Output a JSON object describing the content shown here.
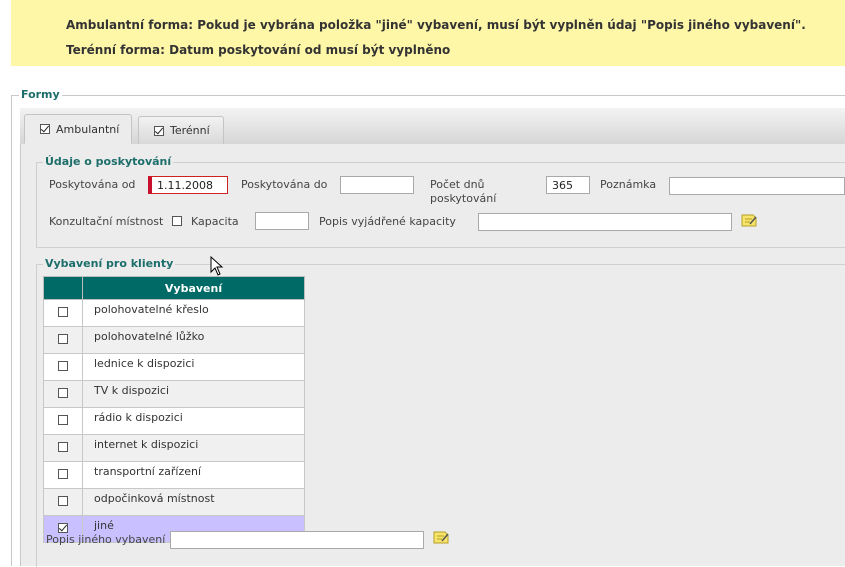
{
  "alert": {
    "line1": "Ambulantní forma: Pokud je vybrána položka \"jiné\" vybavení, musí být vyplněn údaj \"Popis jiného vybavení\".",
    "line2": "Terénní forma: Datum poskytování od musí být vyplněno"
  },
  "forms": {
    "legend": "Formy",
    "tabs": [
      {
        "label": "Ambulantní",
        "checked": true,
        "active": true
      },
      {
        "label": "Terénní",
        "checked": true,
        "active": false
      }
    ]
  },
  "udaje": {
    "legend": "Údaje o poskytování",
    "od_label": "Poskytována od",
    "od_value": "1.11.2008",
    "do_label": "Poskytována do",
    "do_value": "",
    "dny_label_1": "Počet dnů",
    "dny_label_2": "poskytování",
    "dny_value": "365",
    "poznamka_label": "Poznámka",
    "poznamka_value": "",
    "konz_label": "Konzultační místnost",
    "konz_checked": false,
    "kapacita_label": "Kapacita",
    "kapacita_value": "",
    "popis_kap_label": "Popis vyjádřené kapacity",
    "popis_kap_value": ""
  },
  "vybaveni": {
    "legend": "Vybavení pro klienty",
    "column_header": "Vybavení",
    "items": [
      {
        "label": "polohovatelné křeslo",
        "checked": false
      },
      {
        "label": "polohovatelné lůžko",
        "checked": false
      },
      {
        "label": "lednice k dispozici",
        "checked": false
      },
      {
        "label": "TV k dispozici",
        "checked": false
      },
      {
        "label": "rádio k dispozici",
        "checked": false
      },
      {
        "label": "internet k dispozici",
        "checked": false
      },
      {
        "label": "transportní zařízení",
        "checked": false
      },
      {
        "label": "odpočinková místnost",
        "checked": false
      },
      {
        "label": "jiné",
        "checked": true
      }
    ],
    "popis_jineho_label": "Popis jiného vybavení",
    "popis_jineho_value": ""
  },
  "colors": {
    "alert_bg": "#fff7a8",
    "accent_teal": "#006b66",
    "selected_row": "#c9c1ff",
    "invalid_marker": "#c8102e"
  },
  "icons": {
    "note": "note-edit-icon",
    "cursor": "mouse-pointer-icon"
  }
}
